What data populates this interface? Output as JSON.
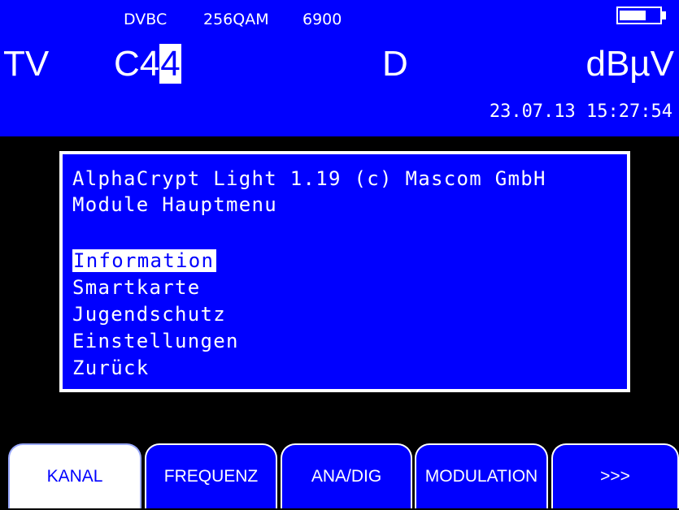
{
  "status": {
    "standard": "DVBC",
    "modulation": "256QAM",
    "symbol_rate": "6900",
    "battery_level": 0.7
  },
  "header": {
    "mode": "TV",
    "channel_prefix": "C4",
    "channel_cursor": "4",
    "band": "D",
    "unit": "dBµV",
    "datetime": "23.07.13 15:27:54"
  },
  "dialog": {
    "title_line": "AlphaCrypt Light 1.19 (c) Mascom GmbH",
    "subtitle_line": "Module Hauptmenu",
    "menu": [
      {
        "label": "Information",
        "selected": true
      },
      {
        "label": "Smartkarte",
        "selected": false
      },
      {
        "label": "Jugendschutz",
        "selected": false
      },
      {
        "label": "Einstellungen",
        "selected": false
      },
      {
        "label": "Zurück",
        "selected": false
      }
    ]
  },
  "softkeys": [
    {
      "label": "KANAL",
      "active": true
    },
    {
      "label": "FREQUENZ",
      "active": false
    },
    {
      "label": "ANA/DIG",
      "active": false
    },
    {
      "label": "MODULATION",
      "active": false
    },
    {
      "label": ">>>",
      "active": false
    }
  ],
  "colors": {
    "screen_bg": "#000000",
    "panel_blue": "#0000ff",
    "text": "#ffffff"
  }
}
